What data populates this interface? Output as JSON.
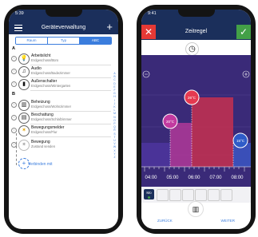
{
  "left_phone": {
    "status_time": "5:39",
    "header_title": "Geräteverwaltung",
    "tabs": [
      {
        "label": "Raum",
        "active": false
      },
      {
        "label": "Typ",
        "active": false
      },
      {
        "label": "ABC",
        "active": true
      }
    ],
    "sections": [
      {
        "letter": "A",
        "items": [
          {
            "name": "Arbeitslicht",
            "location": "Erdgeschoss/Büro",
            "icon": "bulb-icon",
            "glyph": "💡"
          },
          {
            "name": "Audio",
            "location": "Erdgeschoss/Badezimmer",
            "icon": "music-icon",
            "glyph": "♫"
          },
          {
            "name": "Außenschalter",
            "location": "Erdgeschoss/Wintergarten",
            "icon": "switch-icon",
            "glyph": "▮"
          }
        ]
      },
      {
        "letter": "B",
        "items": [
          {
            "name": "Beheizung",
            "location": "Erdgeschoss/Wohnzimmer",
            "icon": "heater-icon",
            "glyph": "▥"
          },
          {
            "name": "Beschattung",
            "location": "Erdgeschoss/Schlafzimmer",
            "icon": "shutter-icon",
            "glyph": "▤"
          },
          {
            "name": "Bewegungsmelder",
            "location": "Erdgeschoss/Flur",
            "icon": "motion-icon",
            "glyph": "✶"
          },
          {
            "name": "Bewegung",
            "location": "Zustand senden",
            "icon": "motion-small-icon",
            "glyph": "✶"
          }
        ]
      }
    ],
    "connect_label": "Verbinden mit",
    "alphabet": "ABCDEFGHIJKLMNOPQRSTUVWXYZ"
  },
  "right_phone": {
    "status_time": "9:41",
    "header_title": "Zeitregel",
    "temperatures": [
      "20°C",
      "26°C",
      "15°C"
    ],
    "times": [
      "04:00",
      "05:00",
      "06:00",
      "07:00",
      "08:00"
    ],
    "day_chip": "Mo",
    "bottom_labels": [
      "ZURÜCK",
      "WEITER"
    ]
  },
  "colors": {
    "header": "#1b2f5b",
    "accent": "#3b7ddd",
    "chart_bg": "#3d2a7a",
    "temp_20": "#c23aa0",
    "temp_26": "#e53950",
    "temp_15": "#2e5bc8"
  }
}
